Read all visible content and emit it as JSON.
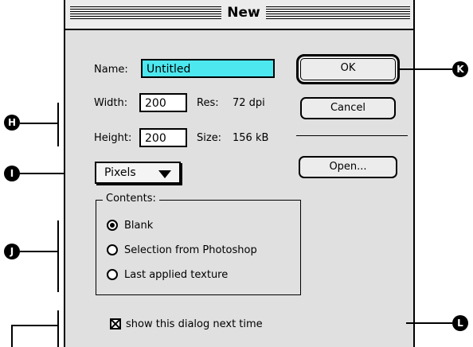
{
  "dialog": {
    "title": "New",
    "name_label": "Name:",
    "name_value": "Untitled",
    "width_label": "Width:",
    "width_value": "200",
    "res_label": "Res:",
    "res_value": "72 dpi",
    "height_label": "Height:",
    "height_value": "200",
    "size_label": "Size:",
    "size_value": "156 kB",
    "units_popup": "Pixels",
    "buttons": {
      "ok": "OK",
      "cancel": "Cancel",
      "open": "Open..."
    },
    "contents": {
      "label": "Contents:",
      "options": [
        {
          "label": "Blank",
          "selected": true
        },
        {
          "label": "Selection from Photoshop",
          "selected": false
        },
        {
          "label": "Last applied texture",
          "selected": false
        }
      ]
    },
    "checkbox": {
      "label": "show this dialog next time",
      "checked": true
    },
    "colors": {
      "selection": "#4de8ef",
      "dialog_bg": "#e0e0e0"
    }
  },
  "callouts": {
    "h": "H",
    "i": "I",
    "j": "J",
    "k": "K",
    "l": "L"
  }
}
